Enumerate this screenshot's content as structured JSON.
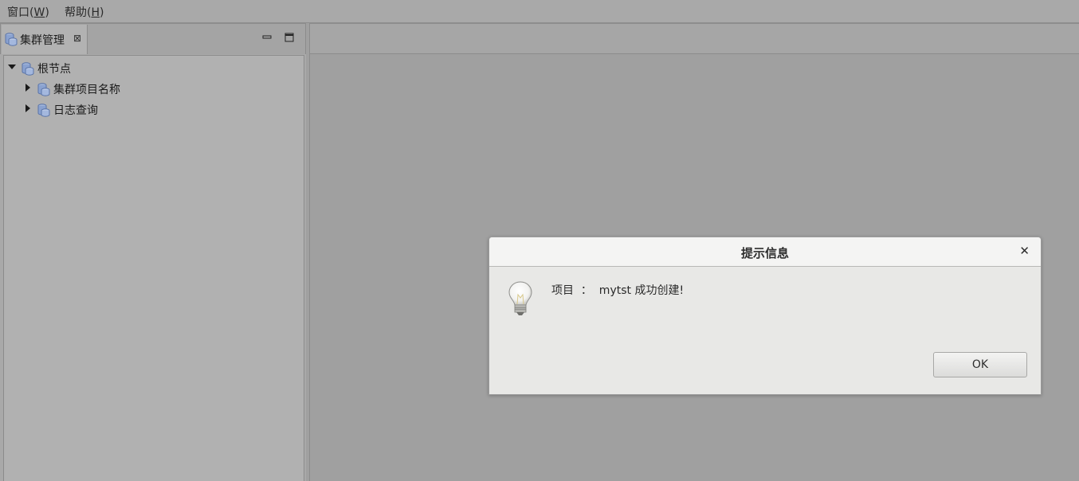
{
  "menubar": {
    "items": [
      {
        "label": "窗口(",
        "mnemonic": "W",
        "suffix": ")"
      },
      {
        "label": "帮助(",
        "mnemonic": "H",
        "suffix": ")"
      }
    ]
  },
  "view": {
    "tab_title": "集群管理",
    "tree": [
      {
        "label": "根节点",
        "expanded": true
      },
      {
        "label": "集群项目名称",
        "expanded": false
      },
      {
        "label": "日志查询",
        "expanded": false
      }
    ]
  },
  "dialog": {
    "title": "提示信息",
    "message": "项目  ：  mytst 成功创建!",
    "ok_label": "OK"
  },
  "colors": {
    "node_icon": "#7c96c8"
  }
}
